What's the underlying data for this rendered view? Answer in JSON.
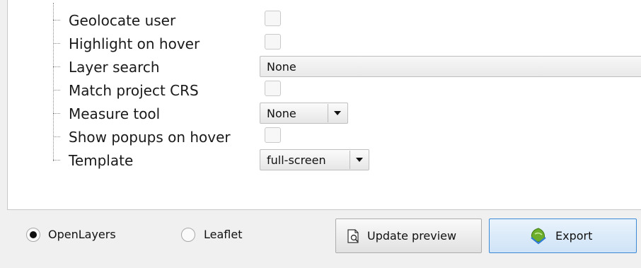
{
  "settings": {
    "items": [
      {
        "label": "Geolocate user",
        "control": "checkbox",
        "checked": false
      },
      {
        "label": "Highlight on hover",
        "control": "checkbox",
        "checked": false
      },
      {
        "label": "Layer search",
        "control": "field",
        "value": "None"
      },
      {
        "label": "Match project CRS",
        "control": "checkbox",
        "checked": false
      },
      {
        "label": "Measure tool",
        "control": "combo",
        "value": "None"
      },
      {
        "label": "Show popups on hover",
        "control": "checkbox",
        "checked": false
      },
      {
        "label": "Template",
        "control": "combo",
        "value": "full-screen"
      }
    ]
  },
  "footer": {
    "radio_openlayers": "OpenLayers",
    "radio_leaflet": "Leaflet",
    "selected": "OpenLayers",
    "update_preview_label": "Update preview",
    "export_label": "Export"
  }
}
